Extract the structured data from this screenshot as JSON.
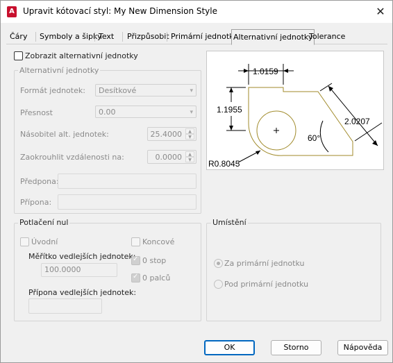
{
  "window": {
    "title": "Upravit kótovací styl: My New Dimension Style",
    "app_icon": "A"
  },
  "tabs": [
    {
      "label": "Čáry"
    },
    {
      "label": "Symboly a šipky"
    },
    {
      "label": "Text"
    },
    {
      "label": "Přizpůsobit"
    },
    {
      "label": "Primární jednotky"
    },
    {
      "label": "Alternativní jednotky",
      "active": true
    },
    {
      "label": "Tolerance"
    }
  ],
  "show_alt_units": {
    "label": "Zobrazit alternativní jednotky",
    "checked": false
  },
  "alt_units": {
    "legend": "Alternativní jednotky",
    "unit_format_label": "Formát jednotek:",
    "unit_format_value": "Desítkové",
    "precision_label": "Přesnost",
    "precision_value": "0.00",
    "multiplier_label": "Násobitel alt. jednotek:",
    "multiplier_value": "25.4000",
    "round_label": "Zaokrouhlit vzdálenosti na:",
    "round_value": "0.0000",
    "prefix_label": "Předpona:",
    "suffix_label": "Přípona:"
  },
  "zero_suppression": {
    "legend": "Potlačení nul",
    "leading_label": "Úvodní",
    "trailing_label": "Koncové",
    "sub_factor_label": "Měřítko vedlejších jednotek:",
    "sub_factor_value": "100.0000",
    "zero_feet_label": "0 stop",
    "zero_inches_label": "0 palců",
    "sub_suffix_label": "Přípona vedlejších jednotek:"
  },
  "placement": {
    "legend": "Umístění",
    "after_label": "Za primární jednotku",
    "below_label": "Pod primární jednotku",
    "selected": "after"
  },
  "preview": {
    "top_dim": "1.0159",
    "left_dim": "1.1955",
    "right_dim": "2.0207",
    "angle": "60°",
    "radius": "R0.8045",
    "shape_color": "#a08a2a"
  },
  "buttons": {
    "ok": "OK",
    "cancel": "Storno",
    "help": "Nápověda"
  }
}
